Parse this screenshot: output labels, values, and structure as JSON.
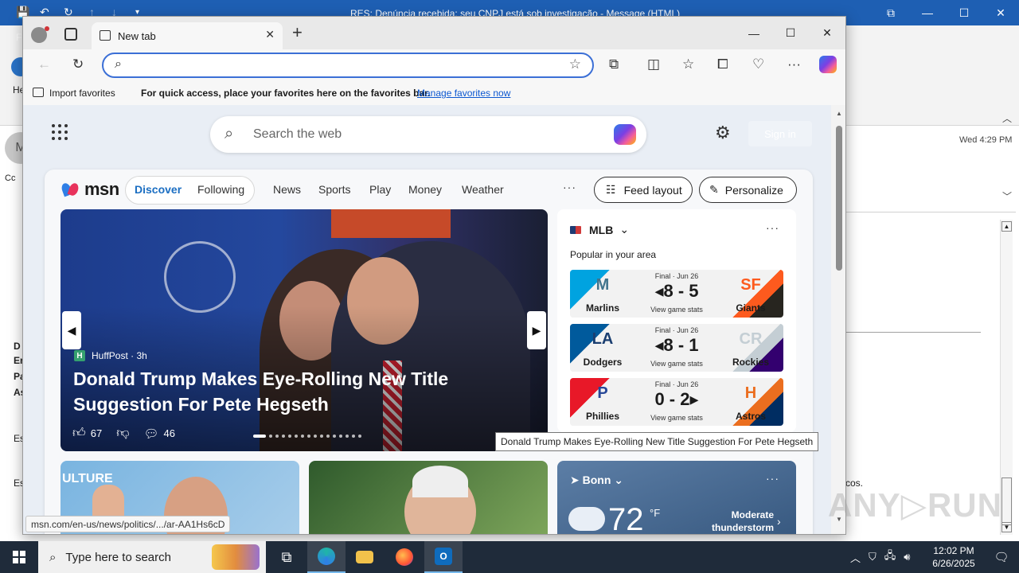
{
  "outlook": {
    "window_title": "RES: Denúncia recebida: seu CNPJ está sob investigação  -  Message (HTML)",
    "file_tab": "Fi",
    "date": "Wed 4:29 PM",
    "text_fragment": "cos.",
    "left_fragments": [
      "He",
      "Cc",
      "D",
      "Er",
      "Pa",
      "As",
      "Es",
      "Es"
    ],
    "avatar_initial": "M",
    "controls": {
      "restore": "⧉",
      "minimize": "—",
      "maximize": "☐",
      "close": "✕"
    },
    "quick_access": [
      "💾",
      "↶",
      "↻",
      "↑",
      "↓",
      "▾"
    ]
  },
  "edge": {
    "tab_label": "New tab",
    "address_placeholder": "",
    "controls": {
      "minimize": "—",
      "maximize": "☐",
      "close": "✕"
    },
    "favorites": {
      "import_label": "Import favorites",
      "hint": "For quick access, place your favorites here on the favorites bar.",
      "manage_link": "Manage favorites now"
    }
  },
  "newtab": {
    "search_placeholder": "Search the web",
    "signin_label": "Sign in",
    "logo": "msn",
    "tabs": {
      "discover": "Discover",
      "following": "Following"
    },
    "nav": [
      "News",
      "Sports",
      "Play",
      "Money",
      "Weather"
    ],
    "more": "···",
    "feed_layout": "Feed layout",
    "personalize": "Personalize"
  },
  "hero": {
    "source": "HuffPost · 3h",
    "title": "Donald Trump Makes Eye-Rolling New Title Suggestion For Pete Hegseth",
    "likes": "67",
    "comments": "46",
    "slide_count": 16,
    "active_slide": 0
  },
  "mlb": {
    "league": "MLB",
    "subtitle": "Popular in your area",
    "more": "···",
    "games": [
      {
        "status": "Final · Jun 26",
        "score": "◂8 - 5",
        "stats": "View game stats",
        "home": "Marlins",
        "away": "Giants",
        "home_logo": "M",
        "away_logo": "SF",
        "home_colors": [
          "#00a3e0",
          "#41748d"
        ],
        "away_colors": [
          "#fd5a1e",
          "#27251f"
        ]
      },
      {
        "status": "Final · Jun 26",
        "score": "◂8 - 1",
        "stats": "View game stats",
        "home": "Dodgers",
        "away": "Rockies",
        "home_logo": "LA",
        "away_logo": "CR",
        "home_colors": [
          "#005a9c",
          "#1a3e70"
        ],
        "away_colors": [
          "#c4ced4",
          "#33006f"
        ]
      },
      {
        "status": "Final · Jun 26",
        "score": "0 - 2▸",
        "stats": "View game stats",
        "home": "Phillies",
        "away": "Astros",
        "home_logo": "P",
        "away_logo": "H",
        "home_colors": [
          "#e81828",
          "#284898"
        ],
        "away_colors": [
          "#eb6e1f",
          "#002d62"
        ]
      }
    ]
  },
  "cards": {
    "card1_word": "ULTURE"
  },
  "weather": {
    "location": "Bonn",
    "temp": "72",
    "unit": "°F",
    "alert": "Moderate thunderstorm warning",
    "more": "···"
  },
  "tooltip": "Donald Trump Makes Eye-Rolling New Title Suggestion For Pete Hegseth",
  "status_url": "msn.com/en-us/news/politics/.../ar-AA1Hs6cD",
  "watermark": "ANY▷RUN",
  "taskbar": {
    "search_placeholder": "Type here to search",
    "time": "12:02 PM",
    "date": "6/26/2025"
  }
}
